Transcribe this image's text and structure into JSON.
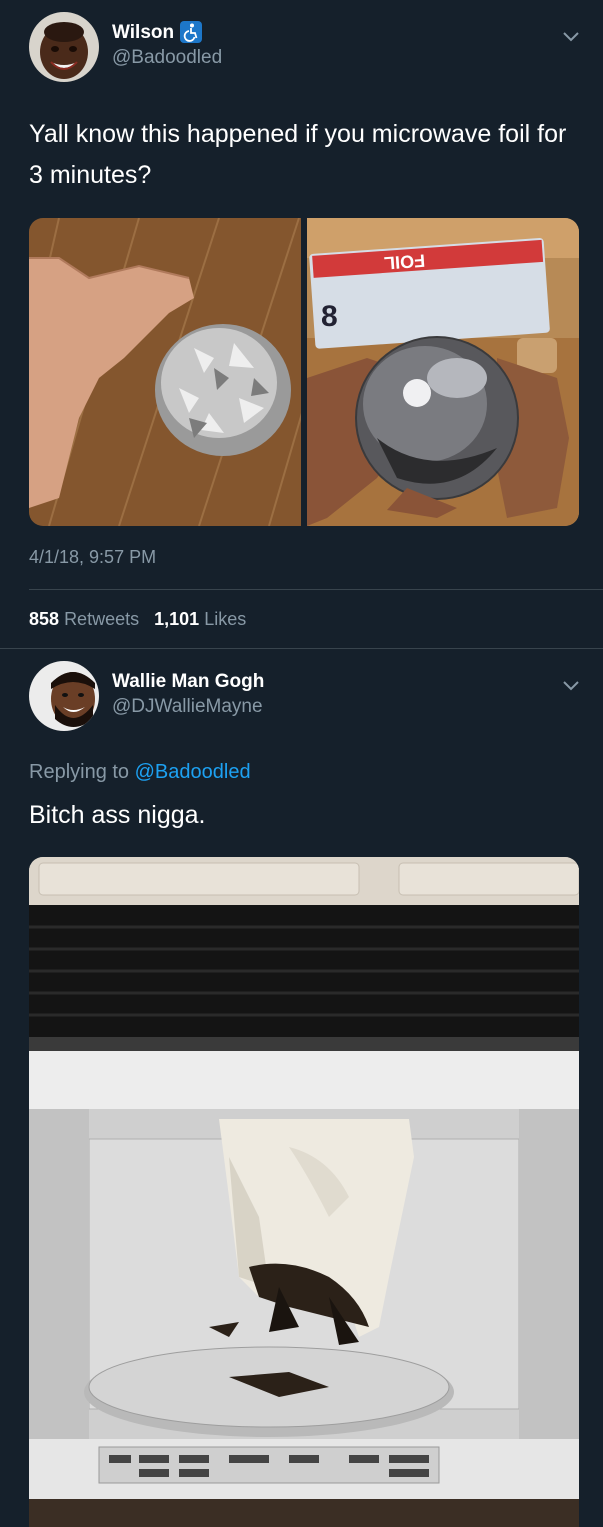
{
  "tweet1": {
    "name": "Wilson",
    "handle": "@Badoodled",
    "text": "Yall know this happened if you microwave foil for 3 minutes?",
    "timestamp": "4/1/18, 9:57 PM",
    "retweets_count": "858",
    "retweets_label": "Retweets",
    "likes_count": "1,101",
    "likes_label": "Likes",
    "badge_icon": "accessibility-icon",
    "foil_box_label": "FOIL",
    "foil_box_number": "8"
  },
  "tweet2": {
    "name": "Wallie Man Gogh",
    "handle": "@DJWallieMayne",
    "replying_prefix": "Replying to",
    "replying_handle": "@Badoodled",
    "text": "Bitch ass nigga."
  },
  "colors": {
    "background": "#15202b",
    "secondary_text": "#8899a6",
    "link": "#1da1f2",
    "divider": "#38444d"
  }
}
